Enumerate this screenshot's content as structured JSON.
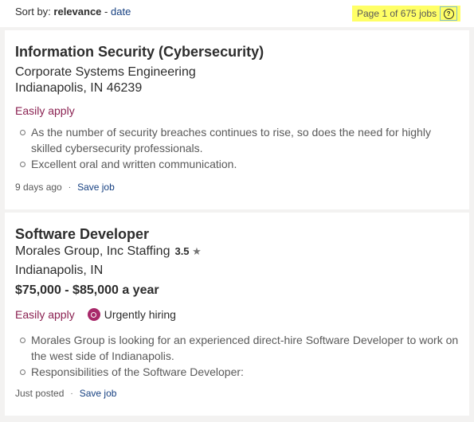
{
  "sort": {
    "label": "Sort by:",
    "selected": "relevance",
    "separator": "-",
    "alternate": "date"
  },
  "pagination": {
    "text": "Page 1 of 675 jobs",
    "help_icon": "question-circle-icon"
  },
  "jobs": [
    {
      "title": "Information Security (Cybersecurity)",
      "company": "Corporate Systems Engineering",
      "location": "Indianapolis, IN 46239",
      "easy_apply": "Easily apply",
      "snippets": [
        "As the number of security breaches continues to rise, so does the need for highly skilled cybersecurity professionals.",
        "Excellent oral and written communication."
      ],
      "posted": "9 days ago",
      "save": "Save job"
    },
    {
      "title": "Software Developer",
      "company": "Morales Group, Inc Staffing",
      "rating": "3.5",
      "star": "★",
      "location": "Indianapolis, IN",
      "salary": "$75,000 - $85,000 a year",
      "easy_apply": "Easily apply",
      "urgent": "Urgently hiring",
      "snippets": [
        "Morales Group is looking for an experienced direct-hire Software Developer to work on the west side of Indianapolis.",
        "Responsibilities of the Software Developer:"
      ],
      "posted": "Just posted",
      "save": "Save job"
    }
  ],
  "meta_separator": "·",
  "colors": {
    "link": "#164081",
    "easy_apply": "#8b2252",
    "highlight": "#ffff66",
    "urgent_icon": "#a8286a"
  }
}
